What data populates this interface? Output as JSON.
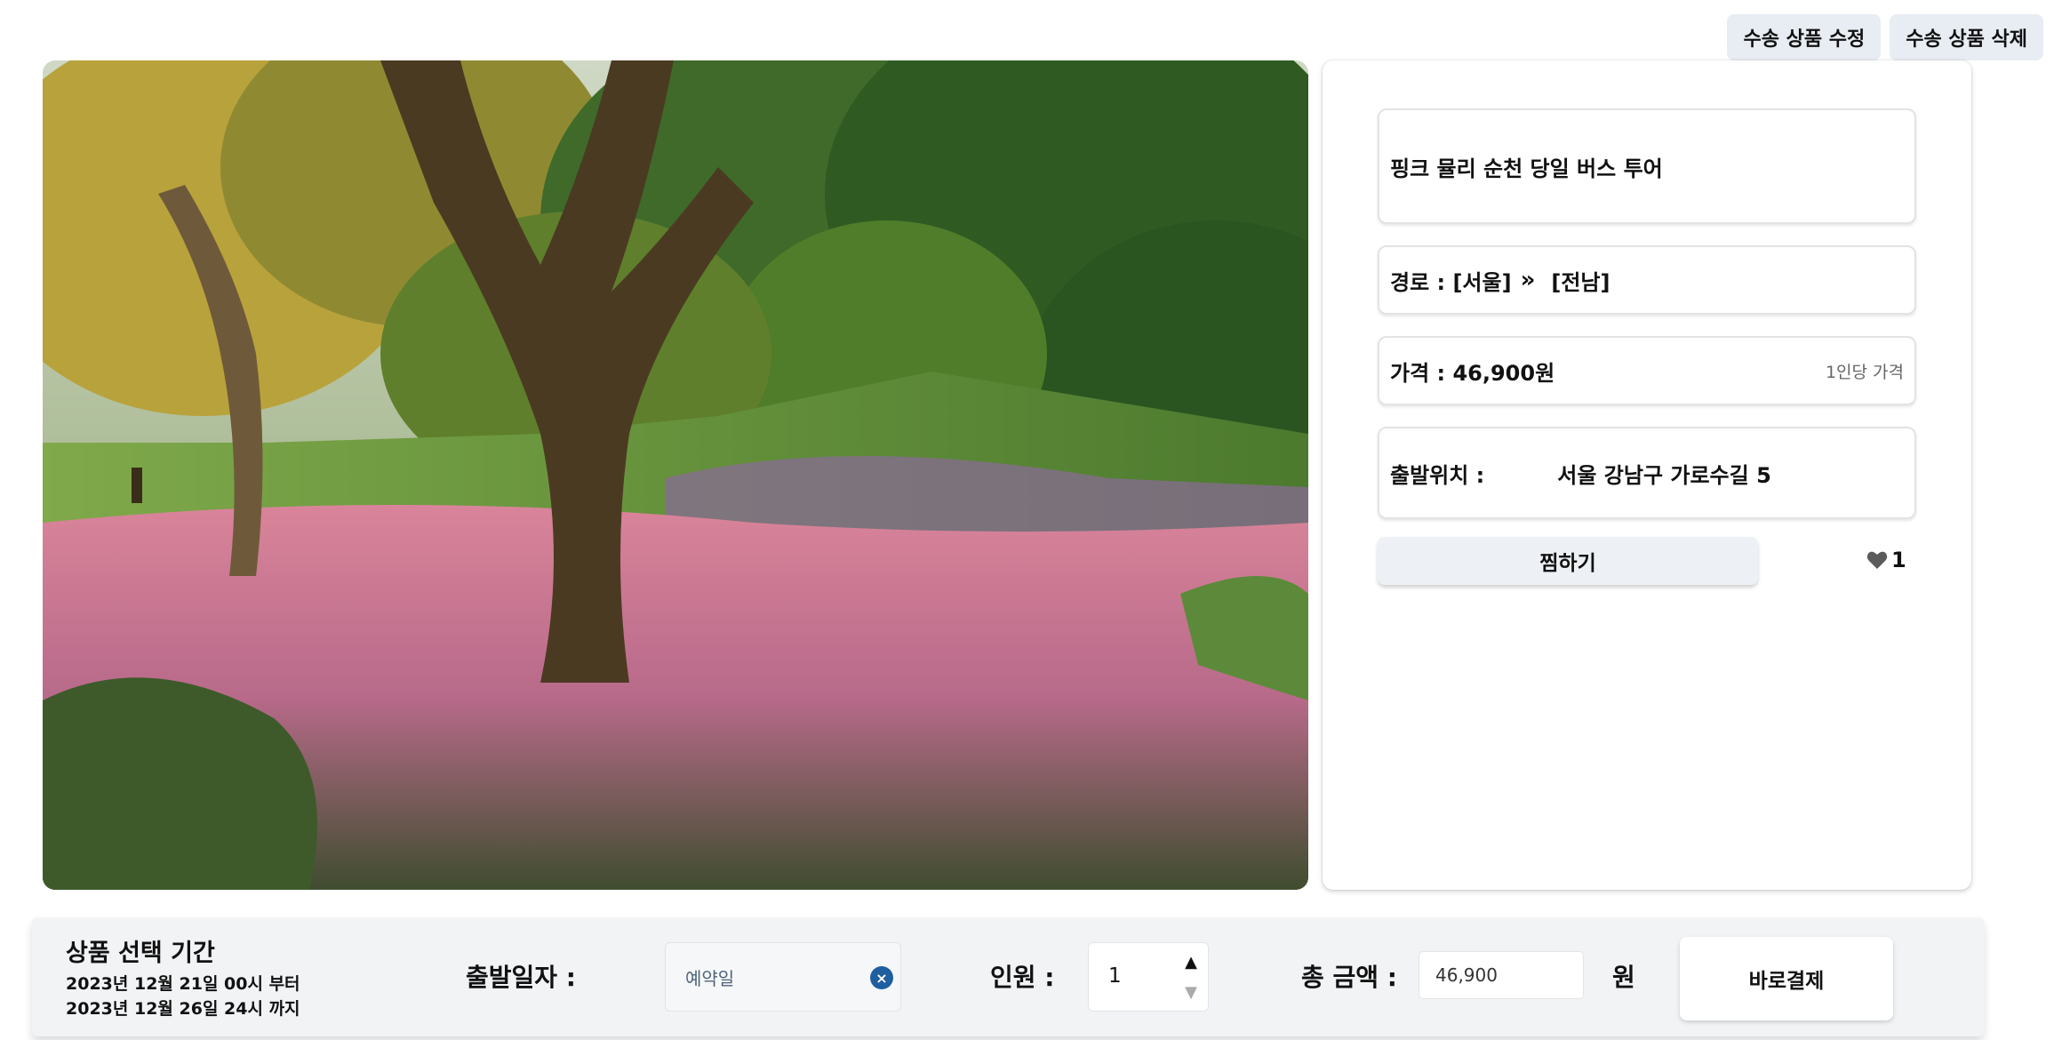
{
  "top_actions": {
    "edit_label": "수송 상품 수정",
    "delete_label": "수송 상품 삭제"
  },
  "product": {
    "title": "핑크 뮬리 순천 당일 버스 투어",
    "route_prefix": "경로 : [서울]",
    "route_separator": "»",
    "route_dest": "[전남]",
    "price_label": "가격 : 46,900원",
    "price_note": "1인당 가격",
    "departure_label": "출발위치 :",
    "departure_address": "서울 강남구 가로수길 5",
    "wish_label": "찜하기",
    "like_count": "1"
  },
  "booking": {
    "period_title": "상품 선택 기간",
    "period_start": "2023년 12월 21일 00시 부터",
    "period_end": "2023년 12월 26일 24시 까지",
    "date_label": "출발일자 :",
    "date_placeholder": "예약일",
    "people_label": "인원 :",
    "people_value": "1",
    "total_label": "총 금액 :",
    "total_value": "46,900",
    "currency": "원",
    "pay_label": "바로결제"
  },
  "icons": {
    "clear": "close-circle-icon",
    "like": "heart-icon",
    "stepper_up": "triangle-up-icon",
    "stepper_down": "triangle-down-icon"
  },
  "colors": {
    "button_bg": "#e8edf3",
    "clear_icon": "#1e5fa0",
    "bar_bg": "#f1f3f5"
  }
}
